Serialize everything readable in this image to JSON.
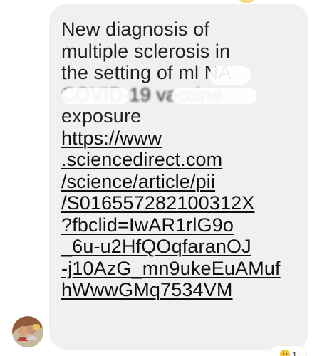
{
  "message": {
    "lines": [
      "New diagnosis of",
      "multiple sclerosis in",
      "the setting of ml NA",
      "COVID-19 vaccine",
      "exposure"
    ],
    "link_lines": [
      "https://www",
      ".sciencedirect.com",
      "/science/article/pii",
      "/S016557282100312X",
      "?fbclid=IwAR1rlG9o",
      "_6u-u2HfQOqfaranOJ",
      "-j10AzG_mn9ukeEuAMuf",
      "hWwwGMq7534VM"
    ]
  },
  "reaction": {
    "count": "1",
    "emoji_icon": "smile-reaction-icon",
    "color": "#f4c542"
  },
  "colors": {
    "bubble_background": "#f0f0f0",
    "text": "#222222",
    "page_background": "#ffffff"
  }
}
